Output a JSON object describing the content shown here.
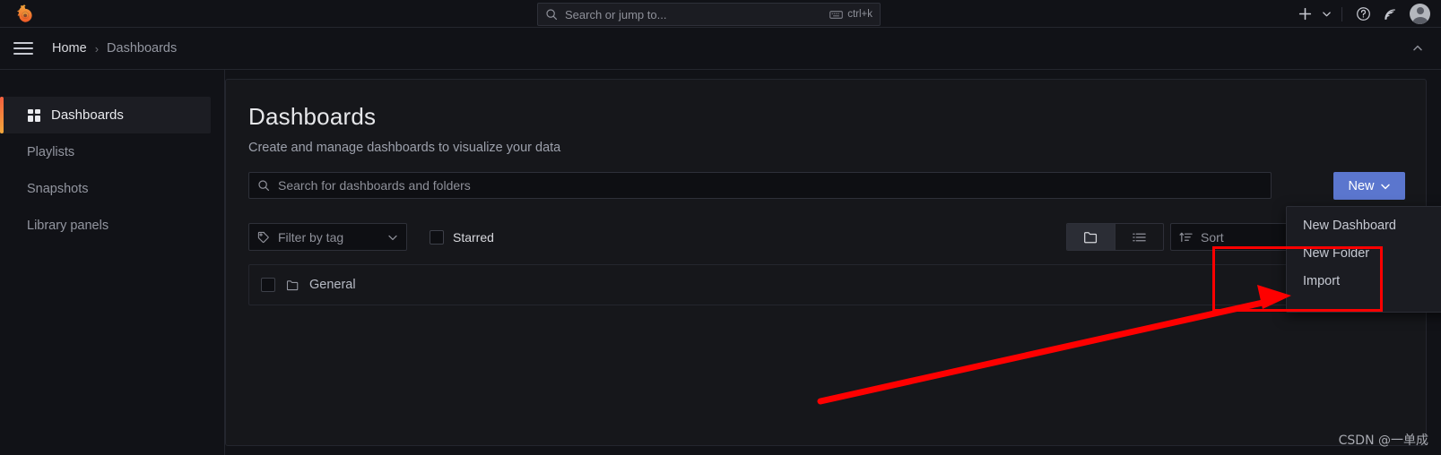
{
  "app": {
    "logo_icon": "grafana-logo-icon",
    "background_color": "#111217",
    "accent_color": "#5b76ce",
    "annotation_color": "#fe0000"
  },
  "topnav": {
    "search": {
      "placeholder": "Search or jump to...",
      "value": "",
      "icon": "search-icon",
      "shortcut_icon": "keyboard-icon",
      "shortcut_label": "ctrl+k"
    },
    "actions": {
      "add_icon": "plus-icon",
      "add_chevron_icon": "chevron-down-icon",
      "help_icon": "question-circle-icon",
      "news_icon": "rss-icon",
      "avatar": "user-avatar"
    }
  },
  "breadcrumb": {
    "menu_icon": "hamburger-menu-icon",
    "items": [
      {
        "label": "Home"
      },
      {
        "label": "Dashboards"
      }
    ],
    "separator": "›",
    "collapse_icon": "chevron-up-icon"
  },
  "sidebar": {
    "items": [
      {
        "label": "Dashboards",
        "icon": "apps-grid-icon",
        "active": true
      },
      {
        "label": "Playlists",
        "icon": "",
        "active": false
      },
      {
        "label": "Snapshots",
        "icon": "",
        "active": false
      },
      {
        "label": "Library panels",
        "icon": "",
        "active": false
      }
    ]
  },
  "main": {
    "title": "Dashboards",
    "subtitle": "Create and manage dashboards to visualize your data",
    "search": {
      "placeholder": "Search for dashboards and folders",
      "value": "",
      "icon": "search-icon"
    },
    "new_button": {
      "label": "New",
      "chevron_icon": "chevron-down-icon"
    },
    "filters": {
      "tag_filter": {
        "label": "Filter by tag",
        "icon": "tag-icon",
        "chevron_icon": "chevron-down-icon"
      },
      "starred": {
        "label": "Starred",
        "checked": false
      }
    },
    "view_toggle": {
      "folder_view_icon": "folder-icon",
      "list_view_icon": "list-icon",
      "active": "folder-view"
    },
    "sort": {
      "label": "Sort",
      "icon": "sort-amount-icon"
    },
    "results": {
      "rows": [
        {
          "label": "General",
          "icon": "folder-icon",
          "checked": false
        }
      ]
    }
  },
  "new_menu": {
    "items": [
      {
        "label": "New Dashboard"
      },
      {
        "label": "New Folder"
      },
      {
        "label": "Import"
      }
    ]
  },
  "watermark": {
    "text": "CSDN @一单成"
  }
}
